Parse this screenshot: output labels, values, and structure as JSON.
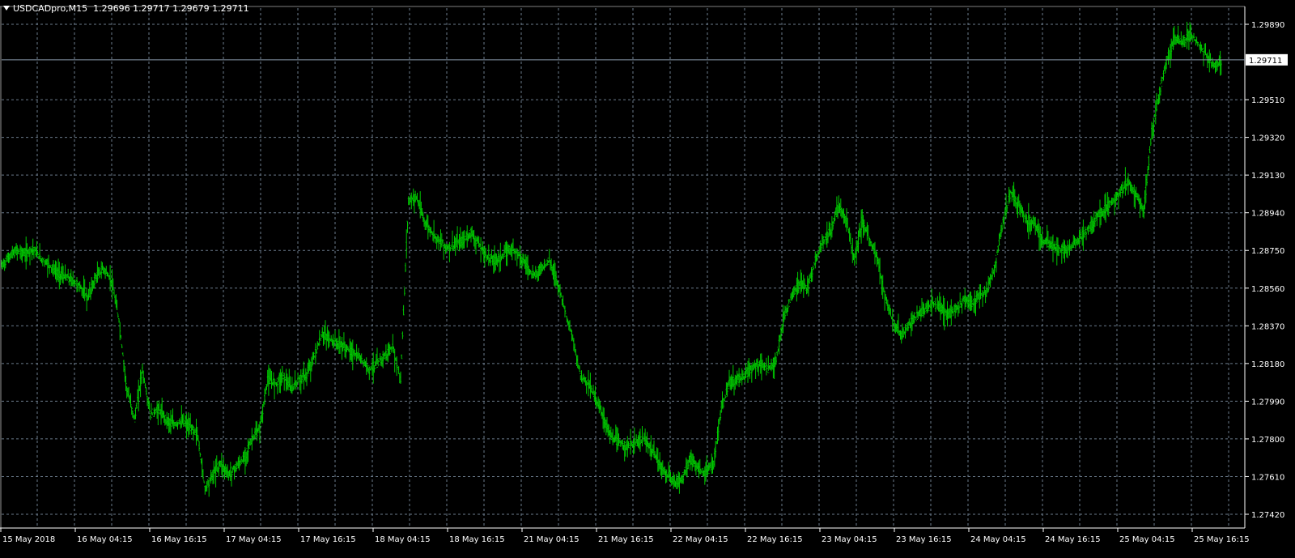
{
  "header": {
    "symbol_timeframe": "USDCADpro,M15",
    "ohlc": "1.29696 1.29717 1.29679 1.29711"
  },
  "current_price_label": "1.29711",
  "colors": {
    "background": "#000000",
    "grid": "#6b7b8c",
    "candles": "#00c800",
    "text": "#ffffff",
    "price_line": "#8a9aab"
  },
  "chart_data": {
    "type": "line",
    "symbol": "USDCADpro",
    "timeframe": "M15",
    "y_ticks": [
      "1.29890",
      "1.29510",
      "1.29320",
      "1.29130",
      "1.28940",
      "1.28750",
      "1.28560",
      "1.28370",
      "1.28180",
      "1.27990",
      "1.27800",
      "1.27610",
      "1.27420"
    ],
    "y_tick_values": [
      1.2989,
      1.2951,
      1.2932,
      1.2913,
      1.2894,
      1.2875,
      1.2856,
      1.2837,
      1.2818,
      1.2799,
      1.278,
      1.2761,
      1.2742
    ],
    "x_ticks": [
      "15 May 2018",
      "16 May 04:15",
      "16 May 16:15",
      "17 May 04:15",
      "17 May 16:15",
      "18 May 04:15",
      "18 May 16:15",
      "21 May 04:15",
      "21 May 16:15",
      "22 May 04:15",
      "22 May 16:15",
      "23 May 04:15",
      "23 May 16:15",
      "24 May 04:15",
      "24 May 16:15",
      "25 May 04:15",
      "25 May 16:15"
    ],
    "ylim": [
      1.2737,
      1.2996
    ],
    "current_price": 1.29711,
    "grid": true,
    "series": [
      {
        "values": [
          1.2867,
          1.2872,
          1.2875,
          1.2873,
          1.2876,
          1.2871,
          1.2868,
          1.2864,
          1.2862,
          1.286,
          1.2857,
          1.2851,
          1.2861,
          1.2866,
          1.286,
          1.284,
          1.2805,
          1.279,
          1.2815,
          1.2792,
          1.2795,
          1.279,
          1.2787,
          1.2789,
          1.2786,
          1.2783,
          1.2755,
          1.2762,
          1.2768,
          1.2762,
          1.2766,
          1.277,
          1.278,
          1.2785,
          1.281,
          1.2808,
          1.2812,
          1.2805,
          1.281,
          1.2812,
          1.2822,
          1.2833,
          1.283,
          1.2828,
          1.2826,
          1.2823,
          1.282,
          1.2815,
          1.2818,
          1.2822,
          1.2826,
          1.281,
          1.29,
          1.2902,
          1.289,
          1.2884,
          1.288,
          1.2876,
          1.2878,
          1.288,
          1.2884,
          1.2878,
          1.2872,
          1.287,
          1.2872,
          1.2876,
          1.2874,
          1.2868,
          1.2862,
          1.2866,
          1.287,
          1.286,
          1.2845,
          1.283,
          1.2812,
          1.2808,
          1.28,
          1.279,
          1.278,
          1.2778,
          1.2776,
          1.2778,
          1.278,
          1.2775,
          1.2768,
          1.2762,
          1.2758,
          1.276,
          1.277,
          1.2765,
          1.2762,
          1.2768,
          1.2795,
          1.2808,
          1.281,
          1.2812,
          1.2816,
          1.2818,
          1.2815,
          1.282,
          1.2842,
          1.2852,
          1.2858,
          1.2856,
          1.287,
          1.288,
          1.2885,
          1.2898,
          1.289,
          1.287,
          1.289,
          1.288,
          1.287,
          1.285,
          1.2838,
          1.2832,
          1.2838,
          1.2842,
          1.2845,
          1.2848,
          1.2846,
          1.2842,
          1.2846,
          1.285,
          1.2848,
          1.2852,
          1.2855,
          1.2868,
          1.289,
          1.2904,
          1.2898,
          1.289,
          1.289,
          1.288,
          1.2878,
          1.2876,
          1.2875,
          1.2878,
          1.2882,
          1.2886,
          1.2892,
          1.2896,
          1.29,
          1.2905,
          1.291,
          1.2903,
          1.2895,
          1.2935,
          1.2955,
          1.2972,
          1.2982,
          1.298,
          1.2984,
          1.2979,
          1.2973,
          1.2968,
          1.2971
        ]
      }
    ]
  }
}
